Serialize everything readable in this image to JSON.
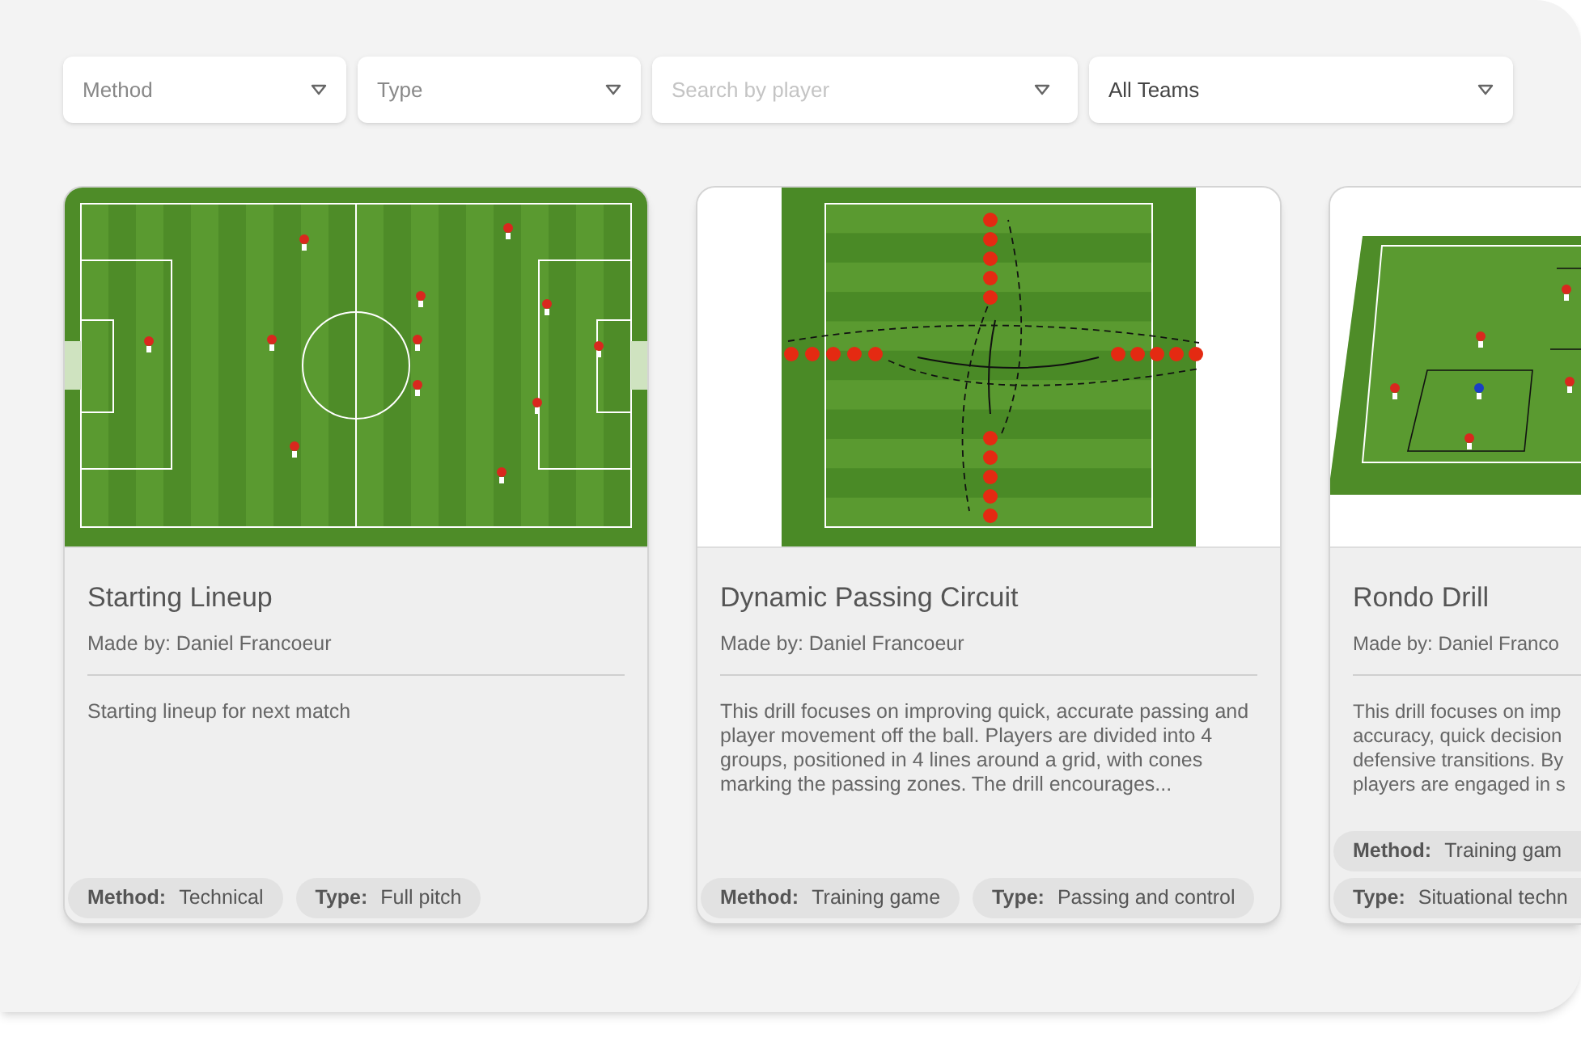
{
  "filters": [
    {
      "kind": "select",
      "placeholder": "Method"
    },
    {
      "kind": "select",
      "placeholder": "Type"
    },
    {
      "kind": "search",
      "placeholder": "Search by player"
    },
    {
      "kind": "select",
      "value": "All Teams"
    }
  ],
  "cards": [
    {
      "kind": "full-pitch",
      "title": "Starting Lineup",
      "author": "Made by: Daniel Francoeur",
      "description": "Starting lineup for next match",
      "tags": [
        {
          "label": "Method:",
          "value": "Technical"
        },
        {
          "label": "Type:",
          "value": "Full pitch"
        }
      ]
    },
    {
      "kind": "grid-drill",
      "title": "Dynamic Passing Circuit",
      "author": "Made by: Daniel Francoeur",
      "description": "This drill focuses on improving quick, accurate passing and player movement off the ball. Players are divided into 4 groups, positioned in 4 lines around a grid, with cones marking the passing zones. The drill encourages...",
      "tags": [
        {
          "label": "Method:",
          "value": "Training game"
        },
        {
          "label": "Type:",
          "value": "Passing and control"
        }
      ]
    },
    {
      "kind": "perspective-pitch",
      "title": "Rondo Drill",
      "author": "Made by: Daniel Franco",
      "description": "This drill focuses on imp\naccuracy, quick decision\ndefensive transitions. By\nplayers are engaged in s",
      "tags": [
        {
          "label": "Method:",
          "value": "Training gam"
        },
        {
          "label": "Type:",
          "value": "Situational techn"
        }
      ]
    }
  ]
}
